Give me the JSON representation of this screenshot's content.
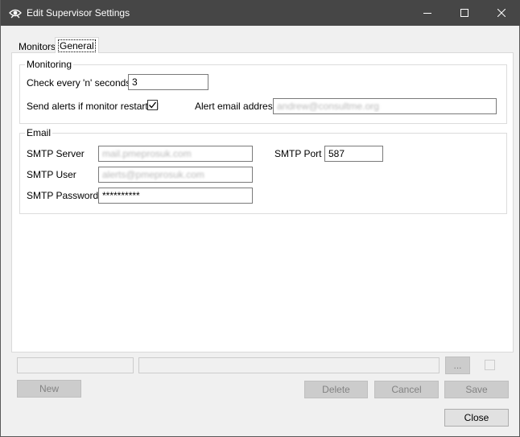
{
  "window": {
    "title": "Edit Supervisor Settings",
    "icon": "eye-settings-icon",
    "controls": {
      "minimize": "minimize-icon",
      "maximize": "maximize-icon",
      "close": "close-icon"
    }
  },
  "tabs": [
    {
      "label": "Monitors",
      "active": false
    },
    {
      "label": "General",
      "active": true
    }
  ],
  "monitoring": {
    "group_label": "Monitoring",
    "check_label": "Check every 'n' seconds",
    "check_value": "3",
    "send_alerts_label": "Send alerts if monitor restarted",
    "send_alerts_checked": true,
    "alert_email_label": "Alert email address",
    "alert_email_value": "andrew@consultme.org"
  },
  "email": {
    "group_label": "Email",
    "smtp_server_label": "SMTP Server",
    "smtp_server_value": "mail.pmeprosuk.com",
    "smtp_port_label": "SMTP Port",
    "smtp_port_value": "587",
    "smtp_user_label": "SMTP User",
    "smtp_user_value": "alerts@pmeprosuk.com",
    "smtp_password_label": "SMTP Password",
    "smtp_password_value": "**********"
  },
  "bottom": {
    "browse_label": "...",
    "new_label": "New",
    "delete_label": "Delete",
    "cancel_label": "Cancel",
    "save_label": "Save",
    "close_label": "Close"
  },
  "colors": {
    "titlebar": "#464646",
    "panel": "#ffffff",
    "window": "#f0f0f0"
  }
}
